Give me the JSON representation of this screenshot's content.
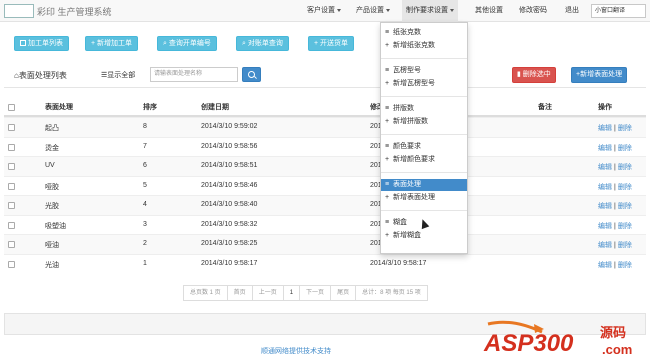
{
  "app": {
    "title": "彩印 生产管理系统"
  },
  "nav": {
    "items": [
      {
        "label": "客户设置",
        "caret": true
      },
      {
        "label": "产品设置",
        "caret": true
      },
      {
        "label": "制作要求设置",
        "caret": true
      },
      {
        "label": "其他设置",
        "caret": false
      },
      {
        "label": "修改密码",
        "caret": false
      },
      {
        "label": "退出",
        "caret": false
      }
    ],
    "tooltip": "小窗口翻译"
  },
  "toolbar": {
    "buttons": [
      "加工单列表",
      "新增加工单",
      "查询开单编号",
      "对账单查询",
      "开送货单"
    ]
  },
  "panel": {
    "title": "表面处理列表",
    "show_all": "显示全部",
    "search_placeholder": "请输表面处理名称",
    "delete_label": "删除选中",
    "add_label": "新增表面处理"
  },
  "table": {
    "headers": [
      "表面处理",
      "排序",
      "创建日期",
      "修改",
      "备注",
      "操作"
    ],
    "rows": [
      {
        "name": "起凸",
        "sort": "8",
        "created": "2014/3/10 9:59:02",
        "modified": "2014/3/10 9:59:02"
      },
      {
        "name": "烫金",
        "sort": "7",
        "created": "2014/3/10 9:58:56",
        "modified": "2014/3/10 9:58:56"
      },
      {
        "name": "UV",
        "sort": "6",
        "created": "2014/3/10 9:58:51",
        "modified": "2014/3/10 9:58:51"
      },
      {
        "name": "哑胶",
        "sort": "5",
        "created": "2014/3/10 9:58:46",
        "modified": "2014/3/10 9:58:46"
      },
      {
        "name": "光胶",
        "sort": "4",
        "created": "2014/3/10 9:58:40",
        "modified": "2014/3/10 9:58:40"
      },
      {
        "name": "吸塑油",
        "sort": "3",
        "created": "2014/3/10 9:58:32",
        "modified": "2014/3/10 9:58:32"
      },
      {
        "name": "哑油",
        "sort": "2",
        "created": "2014/3/10 9:58:25",
        "modified": "2014/3/10 9:58:25"
      },
      {
        "name": "光油",
        "sort": "1",
        "created": "2014/3/10 9:58:17",
        "modified": "2014/3/10 9:58:17"
      }
    ],
    "edit_label": "编辑",
    "separator": "|",
    "delete_label": "删除"
  },
  "pagination": [
    "总页数 1 页",
    "首页",
    "上一页",
    "1",
    "下一页",
    "尾页",
    "总计：8 项 每页 15 项"
  ],
  "dropdown": {
    "groups": [
      [
        "纸张克数",
        "新增纸张克数"
      ],
      [
        "瓦楞型号",
        "新增瓦楞型号"
      ],
      [
        "拼版数",
        "新增拼版数"
      ],
      [
        "颜色要求",
        "新增颜色要求"
      ],
      [
        "表面处理",
        "新增表面处理"
      ],
      [
        "糊盒",
        "新增糊盒"
      ]
    ],
    "active": "表面处理"
  },
  "footer": {
    "credit": "顺通网络提供技术支持"
  },
  "watermark": {
    "text": "ASP300",
    "suffix": "源码",
    "url": ".com"
  },
  "colors": {
    "primary": "#428bca",
    "info": "#5bc0de",
    "danger": "#d9534f"
  }
}
